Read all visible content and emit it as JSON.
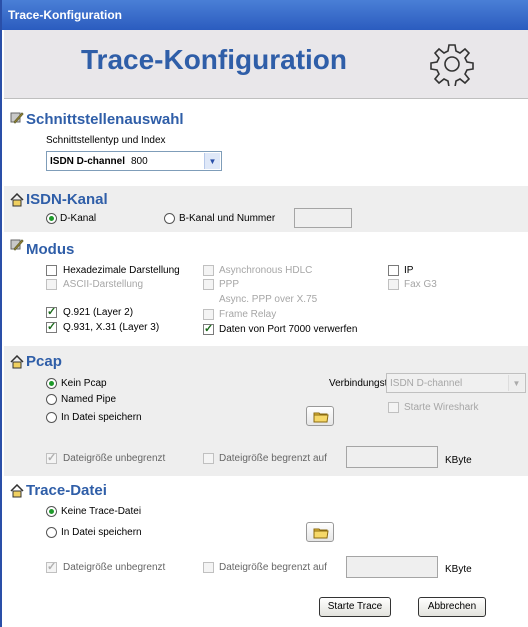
{
  "window": {
    "title": "Trace-Konfiguration"
  },
  "header": {
    "title": "Trace-Konfiguration",
    "icon": "gear-icon"
  },
  "schnittstelle": {
    "title": "Schnittstellenauswahl",
    "type_label": "Schnittstellentyp und Index",
    "type_value": "ISDN D-channel",
    "index_value": "800"
  },
  "isdn": {
    "title": "ISDN-Kanal",
    "d_kanal": "D-Kanal",
    "b_kanal": "B-Kanal und Nummer",
    "b_value": ""
  },
  "modus": {
    "title": "Modus",
    "hex": "Hexadezimale Darstellung",
    "ascii": "ASCII-Darstellung",
    "q921": "Q.921 (Layer 2)",
    "q931": "Q.931, X.31 (Layer 3)",
    "async_hdlc": "Asynchronous HDLC",
    "ppp": "PPP",
    "async_ppp": "Async. PPP over X.75",
    "frame_relay": "Frame Relay",
    "port7000": "Daten von Port 7000 verwerfen",
    "ip": "IP",
    "fax": "Fax G3"
  },
  "pcap": {
    "title": "Pcap",
    "kein": "Kein Pcap",
    "named_pipe": "Named Pipe",
    "datei": "In Datei  speichern",
    "verbindungstyp_label": "Verbindungstyp",
    "verbindungstyp_value": "ISDN D-channel",
    "wireshark": "Starte Wireshark",
    "unbegrenzt": "Dateigröße unbegrenzt",
    "begrenzt": "Dateigröße begrenzt auf",
    "unit": "KByte"
  },
  "trace": {
    "title": "Trace-Datei",
    "keine": "Keine Trace-Datei",
    "datei": "In Datei speichern",
    "unbegrenzt": "Dateigröße unbegrenzt",
    "begrenzt": "Dateigröße begrenzt auf",
    "unit": "KByte"
  },
  "buttons": {
    "start": "Starte Trace",
    "cancel": "Abbrechen"
  }
}
